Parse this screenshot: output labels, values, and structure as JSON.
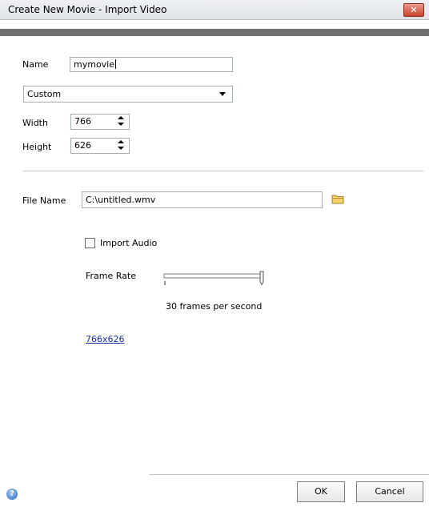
{
  "window": {
    "title": "Create New Movie - Import Video",
    "close_label": "✕"
  },
  "form": {
    "name_label": "Name",
    "name_value": "mymovie",
    "preset_value": "Custom",
    "width_label": "Width",
    "width_value": "766",
    "height_label": "Height",
    "height_value": "626",
    "file_name_label": "File Name",
    "file_name_value": "C:\\untitled.wmv",
    "import_audio_label": "Import Audio",
    "import_audio_checked": false,
    "frame_rate_label": "Frame Rate",
    "frame_rate_value": 1.0,
    "frame_rate_text": "30 frames per second",
    "size_link": "766x626"
  },
  "footer": {
    "ok_label": "OK",
    "cancel_label": "Cancel"
  },
  "icons": {
    "folder": "folder-icon",
    "help": "help-icon",
    "close": "close-icon"
  },
  "colors": {
    "dark_bar": "#707070",
    "link": "#1a2ea8",
    "close": "#c9432c"
  }
}
